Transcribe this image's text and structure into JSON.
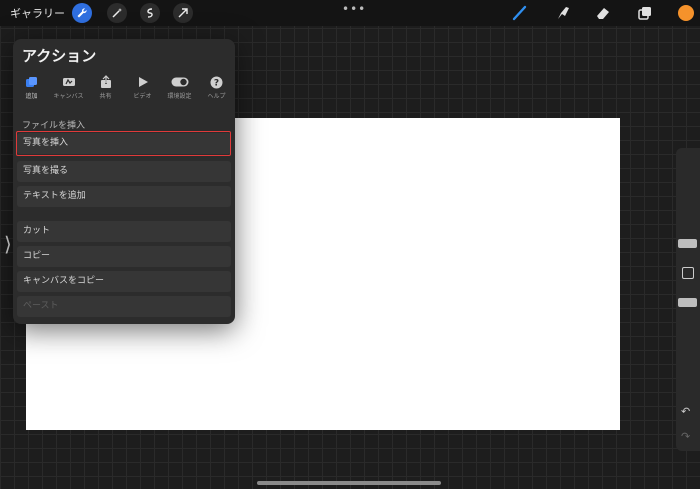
{
  "topbar": {
    "gallery_label": "ギャラリー",
    "more_dots": "•••",
    "tools_left": [
      "wrench-icon",
      "magic-wand-icon",
      "selection-icon",
      "transform-icon"
    ],
    "tools_right": [
      "brush-icon",
      "smudge-icon",
      "eraser-icon",
      "layers-icon",
      "color-icon"
    ],
    "accent_color": "#2f6fe0",
    "color_swatch": "#f5922b"
  },
  "actions_panel": {
    "title": "アクション",
    "tabs": [
      {
        "label": "追加",
        "icon": "add-icon",
        "active": true
      },
      {
        "label": "キャンバス",
        "icon": "canvas-icon",
        "active": false
      },
      {
        "label": "共有",
        "icon": "share-icon",
        "active": false
      },
      {
        "label": "ビデオ",
        "icon": "video-play-icon",
        "active": false
      },
      {
        "label": "環境設定",
        "icon": "toggle-icon",
        "active": false
      },
      {
        "label": "ヘルプ",
        "icon": "help-icon",
        "active": false
      }
    ],
    "section_insert_header": "ファイルを挿入",
    "items": {
      "insert_photo": "写真を挿入",
      "take_photo": "写真を撮る",
      "add_text": "テキストを追加",
      "cut": "カット",
      "copy": "コピー",
      "copy_canvas": "キャンバスをコピー",
      "paste": "ペースト"
    }
  },
  "sidebar": {
    "undo_icon": "undo-icon",
    "redo_icon": "redo-icon"
  }
}
